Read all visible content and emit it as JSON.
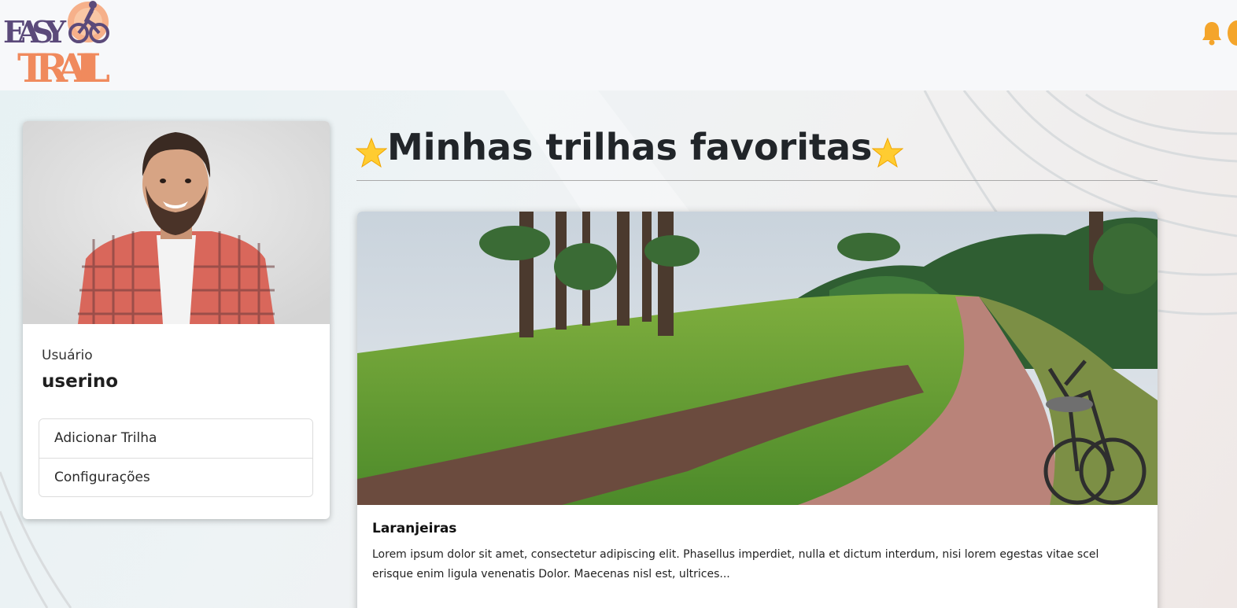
{
  "header": {
    "logo": {
      "line1": "EASY",
      "line2": "TRAIL",
      "icon": "cyclist-logo-icon"
    },
    "notifications_icon": "bell-icon",
    "colors": {
      "bell": "#f4a52b",
      "logo_purple": "#5b4a7a",
      "logo_orange": "#f08a5d"
    }
  },
  "profile": {
    "photo_icon": "profile-photo",
    "label": "Usuário",
    "name": "userino",
    "menu": [
      {
        "label": "Adicionar Trilha"
      },
      {
        "label": "Configurações"
      }
    ]
  },
  "main": {
    "title": "Minhas trilhas favoritas",
    "star_icon": "star-icon",
    "trails": [
      {
        "name": "Laranjeiras",
        "description": "Lorem ipsum dolor sit amet, consectetur adipiscing elit. Phasellus imperdiet, nulla et dictum interdum, nisi lorem egestas vitae scel erisque enim ligula venenatis Dolor. Maecenas nisl est, ultrices..."
      }
    ]
  }
}
